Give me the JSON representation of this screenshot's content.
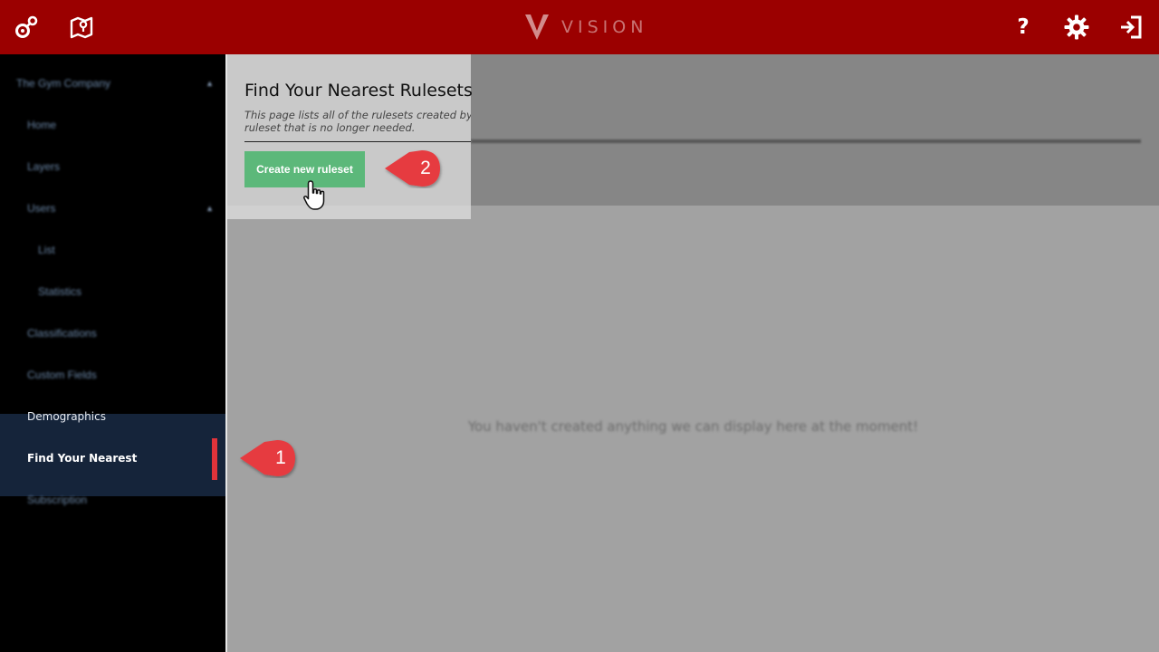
{
  "app": {
    "name": "VISION"
  },
  "topbar": {
    "icons": [
      "gear-link-icon",
      "map-location-icon",
      "help-icon",
      "settings-icon",
      "logout-icon"
    ],
    "help_label": "?"
  },
  "sidebar": {
    "items": [
      {
        "label": "The Gym Company",
        "caret": "▲"
      },
      {
        "label": "Home"
      },
      {
        "label": "Layers"
      },
      {
        "label": "Users",
        "caret": "▲"
      },
      {
        "label": "List"
      },
      {
        "label": "Statistics"
      },
      {
        "label": "Classifications"
      },
      {
        "label": "Custom Fields"
      },
      {
        "label": "Demographics"
      },
      {
        "label": "Find Your Nearest"
      },
      {
        "label": "Subscription"
      }
    ]
  },
  "main": {
    "title": "Find Your Nearest Rulesets",
    "description_line1": "This page lists all of the rulesets created by the organisation to distribute enquiries coming in through the API. You can create a new ruleset, change an existing ruleset, or delete a",
    "description_line2": "ruleset that is no longer needed.",
    "create_button": "Create new ruleset",
    "empty_message": "You haven't created anything we can display here at the moment!"
  },
  "callouts": [
    "1",
    "2"
  ],
  "colors": {
    "topbar": "#9b0000",
    "sidebar": "#000000",
    "active_item_bg": "#15243a",
    "active_indicator": "#e0333a",
    "button": "#5cb87a",
    "callout": "#e63b40"
  }
}
